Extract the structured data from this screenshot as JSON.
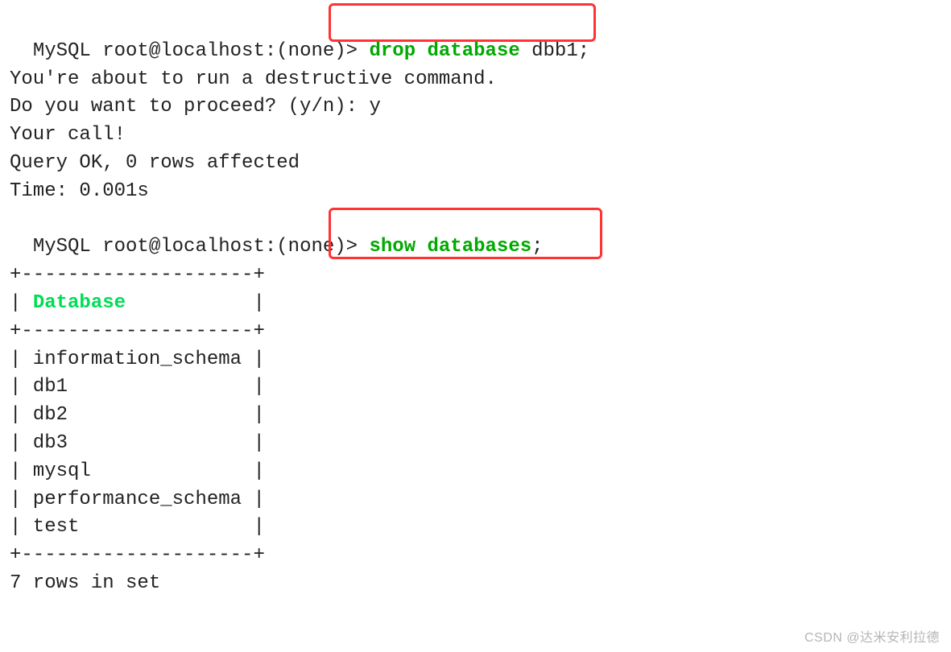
{
  "prompt1": {
    "prefix": "MySQL root@localhost:(none)>",
    "cmd_kw": "drop database",
    "cmd_arg": " dbb1;"
  },
  "warn_line": "You're about to run a destructive command.",
  "proceed_line": "Do you want to proceed? (y/n): y",
  "call_line": "Your call!",
  "query_ok_line": "Query OK, 0 rows affected",
  "time_line": "Time: 0.001s",
  "prompt2": {
    "prefix": "MySQL root@localhost:(none)>",
    "cmd_kw": "show databases",
    "cmd_suffix": ";"
  },
  "table": {
    "border_top": "+--------------------+",
    "header_prefix": "| ",
    "header": "Database",
    "header_suffix": "           |",
    "border_mid": "+--------------------+",
    "rows": [
      "| information_schema |",
      "| db1                |",
      "| db2                |",
      "| db3                |",
      "| mysql              |",
      "| performance_schema |",
      "| test               |"
    ],
    "border_bot": "+--------------------+"
  },
  "rows_in_set": "7 rows in set",
  "watermark": "CSDN @达米安利拉德"
}
